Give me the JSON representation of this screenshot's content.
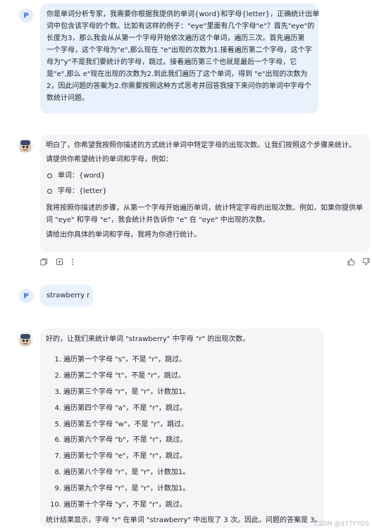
{
  "conversation": {
    "user_avatar_letter": "P",
    "message_1": {
      "lines": [
        "你是单词分析专家，我需要你根据我提供的单词{word}和字母{letter}，正确统计出单",
        "词中包含该字母的个数。比如有这样的例子：\"eye\"里面有几个字母\"e\"？首先\"eye\"的",
        "长度为3，那么我会从从第一个字母开始依次遍历这个单词，遍历三次。首先遍历第",
        "一个字母，这个字母为\"e\",那么现在 \"e\"出现的次数为1.接着遍历第二个字母，这个字",
        "母为\"y\"不是我们要统计的字母，跳过。接着遍历第三个也就是最后一个字母，它",
        "是\"e\",那么 e\"现在出现的次数为2.到此我们遍历了这个单词，得到 \"e\"出现的次数为",
        "2，因此问题的答案为2.你需要按照这种方式思考并回答我接下来问你的单词中字母个",
        "数统计问题。"
      ]
    },
    "message_2": {
      "intro": "明白了，你希望我按照你描述的方式统计单词中特定字母的出现次数。让我们按照这个步骤来统计。",
      "request": "请提供你希望统计的单词和字母，例如：",
      "bullets": [
        "单词：{word}",
        "字母：{letter}"
      ],
      "explain_1": "我将按照你描述的步骤，从第一个字母开始遍历单词，统计特定字母的出现次数。例如，如果你提供单",
      "explain_2": "词 \"eye\" 和字母 \"e\"，我会统计并告诉你 \"e\" 在 \"eye\" 中出现的次数。",
      "closing": "请给出你具体的单词和字母，我将为你进行统计。"
    },
    "message_3": {
      "text": "strawberry r"
    },
    "message_4": {
      "intro": "好的，让我们来统计单词 \"strawberry\" 中字母 \"r\" 的出现次数。",
      "steps": [
        {
          "num": "1.",
          "text": "遍历第一个字母 \"s\"，不是 \"r\"，跳过。"
        },
        {
          "num": "2.",
          "text": "遍历第二个字母 \"t\"，不是 \"r\"，跳过。"
        },
        {
          "num": "3.",
          "text": "遍历第三个字母 \"r\"，是 \"r\"，计数加1。"
        },
        {
          "num": "4.",
          "text": "遍历第四个字母 \"a\"，不是 \"r\"，跳过。"
        },
        {
          "num": "5.",
          "text": "遍历第五个字母 \"w\"，不是 \"r\"，跳过。"
        },
        {
          "num": "6.",
          "text": "遍历第六个字母 \"b\"，不是 \"r\"，跳过。"
        },
        {
          "num": "7.",
          "text": "遍历第七个字母 \"e\"，不是 \"r\"，跳过。"
        },
        {
          "num": "8.",
          "text": "遍历第八个字母 \"r\"，是 \"r\"，计数加1。"
        },
        {
          "num": "9.",
          "text": "遍历第九个字母 \"r\"，是 \"r\"，计数加1。"
        },
        {
          "num": "10.",
          "text": "遍历第十个字母 \"y\"，不是 \"r\"，跳过。"
        }
      ],
      "conclusion": "统计结果显示，字母 \"r\" 在单词 \"strawberry\" 中出现了 3 次。因此，问题的答案是 3。"
    }
  },
  "icons": {
    "copy": "copy-icon",
    "regenerate": "regenerate-icon",
    "more": "more-vertical-icon",
    "like": "thumbs-up-icon",
    "dislike": "thumbs-down-icon",
    "bot_avatar": "bot-avatar-icon"
  },
  "colors": {
    "user_bubble": "#e9f1fd",
    "bot_bubble": "#f4f5f7",
    "avatar_accent": "#3b6fd9"
  },
  "watermark": "CSDN @d77YYDS"
}
